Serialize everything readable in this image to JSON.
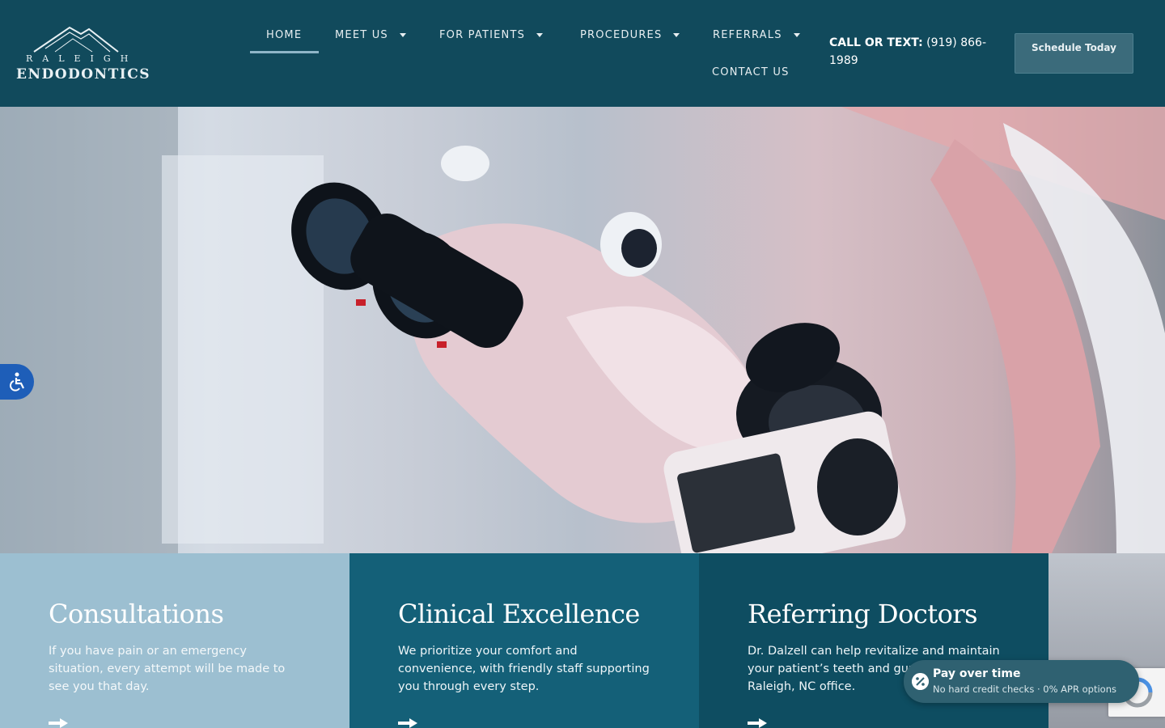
{
  "logo": {
    "top_text": "RALEIGH",
    "main_text": "ENDODONTICS"
  },
  "nav": {
    "home": "HOME",
    "meet_us": "MEET US",
    "for_patients": "FOR PATIENTS",
    "procedures": "PROCEDURES",
    "referrals": "REFERRALS",
    "contact_us": "CONTACT US"
  },
  "call": {
    "label": "CALL OR TEXT:",
    "number": "(919) 866-1989"
  },
  "schedule_button": "Schedule Today",
  "cards": [
    {
      "title": "Consultations",
      "text": "If you have pain or an emergency situation, every attempt will be made to see you that day."
    },
    {
      "title": "Clinical Excellence",
      "text": "We prioritize your comfort and convenience, with friendly staff supporting you through every step."
    },
    {
      "title": "Referring Doctors",
      "text": "Dr. Dalzell can help revitalize and maintain your patient’s teeth and gums in our Raleigh, NC office."
    }
  ],
  "pay_widget": {
    "title": "Pay over time",
    "subtitle": "No hard credit checks · 0% APR options"
  },
  "colors": {
    "header": "#114a5c",
    "card1": "#9cbfd1",
    "card2": "#146078",
    "card3": "#0e4d61",
    "accessibility": "#1e5eb8"
  }
}
